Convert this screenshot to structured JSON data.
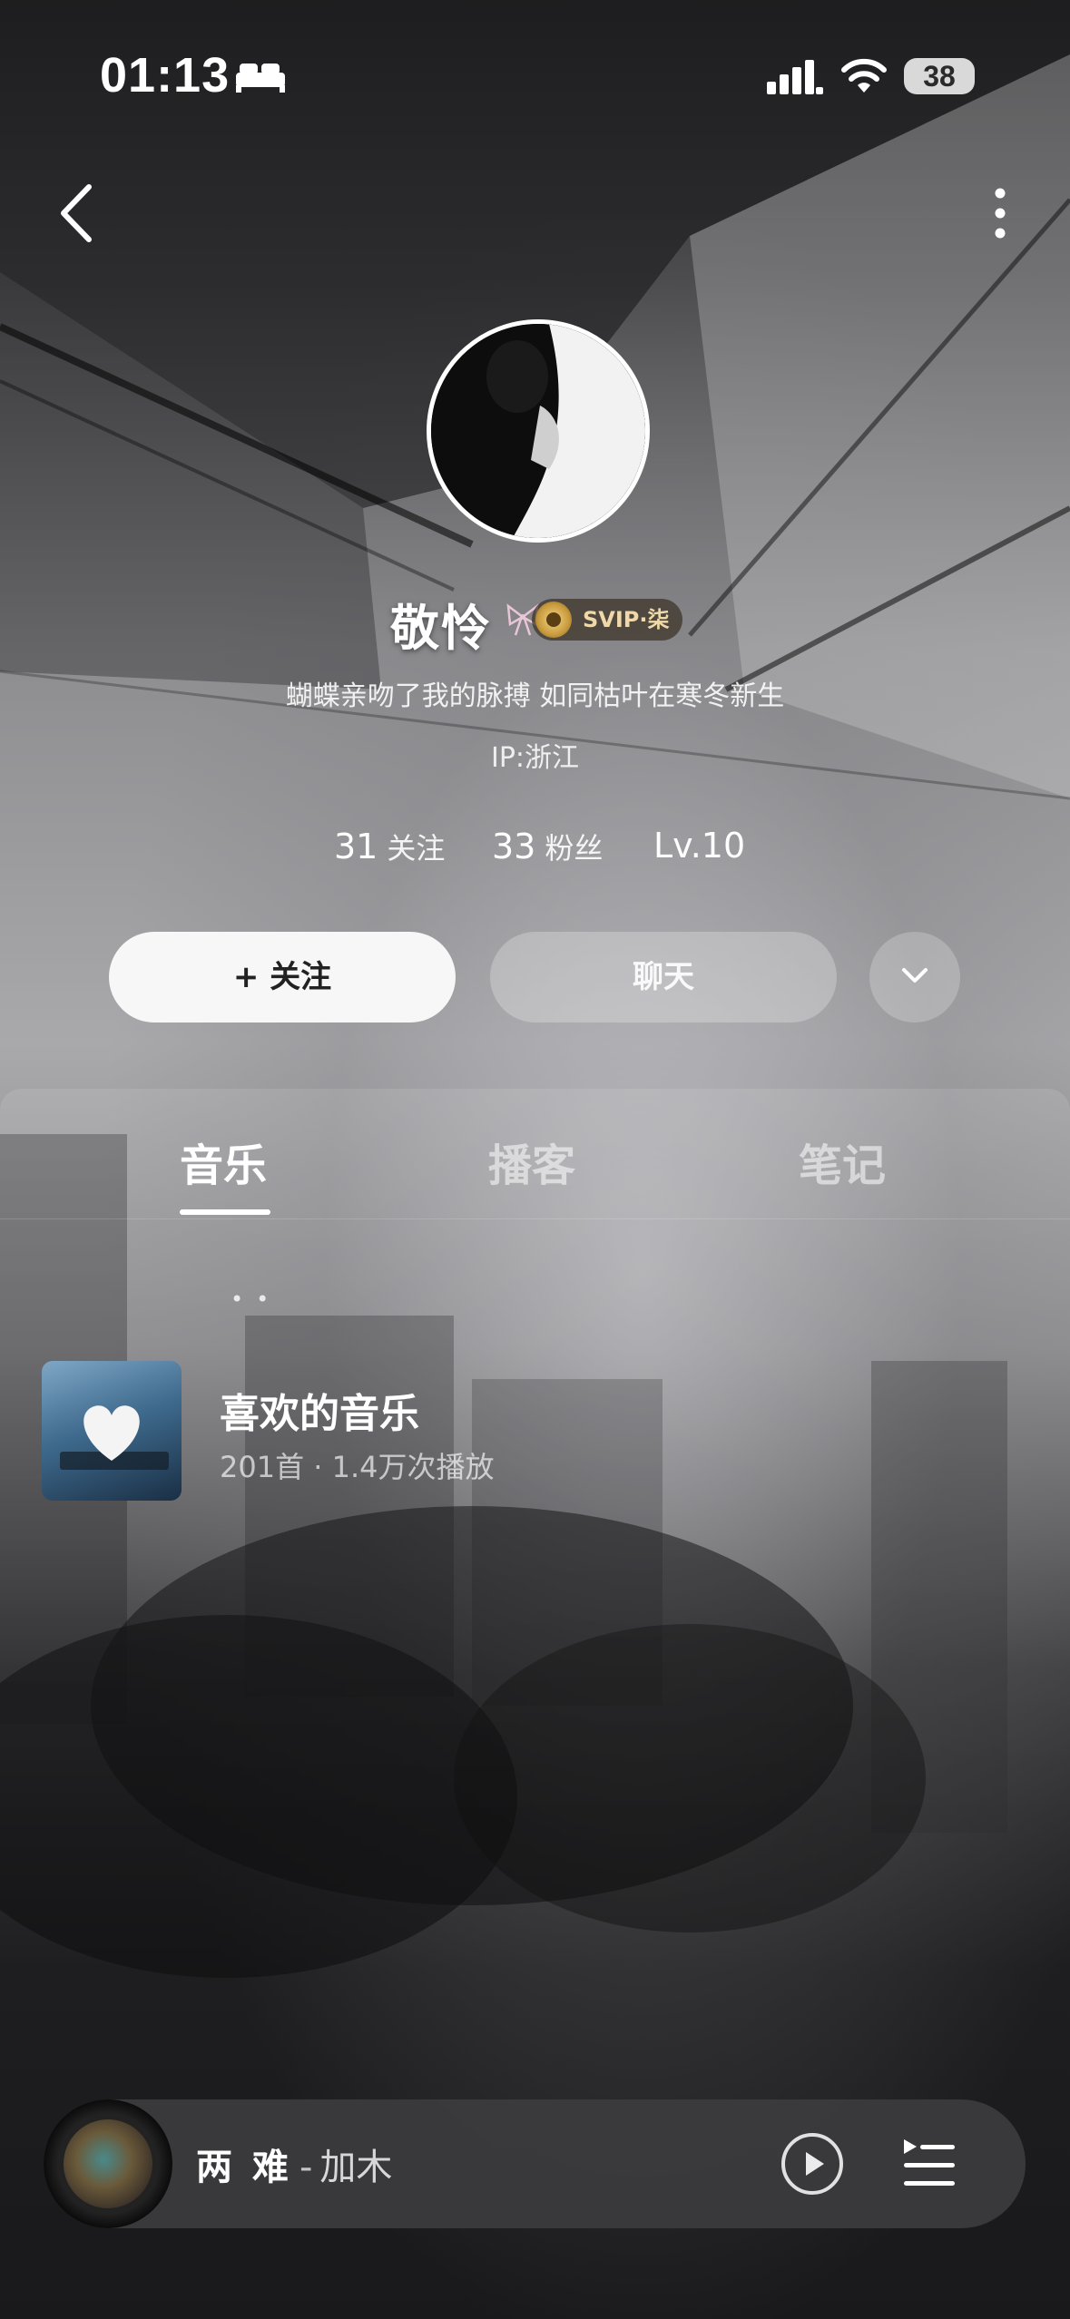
{
  "status_bar": {
    "time": "01:13",
    "battery": "38"
  },
  "profile": {
    "username": "敬怜",
    "vip_label": "SVIP·柒",
    "bio": "蝴蝶亲吻了我的脉搏 如同枯叶在寒冬新生",
    "ip": "IP:浙江",
    "stats": {
      "following_count": "31",
      "following_label": "关注",
      "fans_count": "33",
      "fans_label": "粉丝",
      "level": "Lv.10"
    }
  },
  "actions": {
    "follow_label": "+ 关注",
    "chat_label": "聊天"
  },
  "tabs": [
    {
      "label": "音乐",
      "active": true
    },
    {
      "label": "播客",
      "active": false
    },
    {
      "label": "笔记",
      "active": false
    }
  ],
  "playlist": {
    "title": "喜欢的音乐",
    "meta": "201首 · 1.4万次播放"
  },
  "player": {
    "song_title": "两 难",
    "separator": "-",
    "artist": "加木"
  },
  "icons": {
    "back": "back-icon",
    "more": "more-icon",
    "expand": "chevron-down-icon",
    "play": "play-icon",
    "queue": "playlist-queue-icon"
  }
}
